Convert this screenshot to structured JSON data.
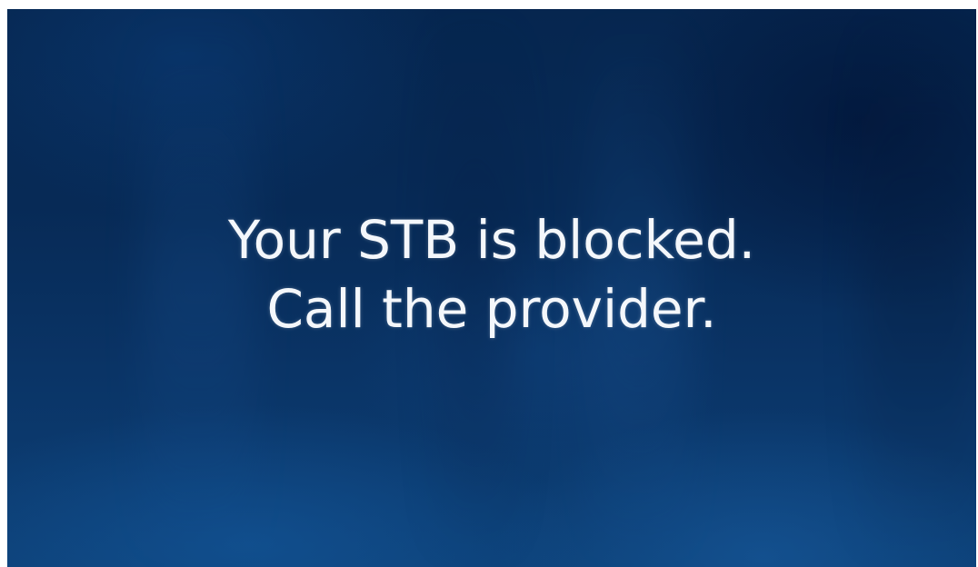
{
  "screen": {
    "message_line_1": "Your STB is blocked.",
    "message_line_2": "Call the provider.",
    "background_color": "#072a56",
    "text_color": "#f4f7fb"
  }
}
